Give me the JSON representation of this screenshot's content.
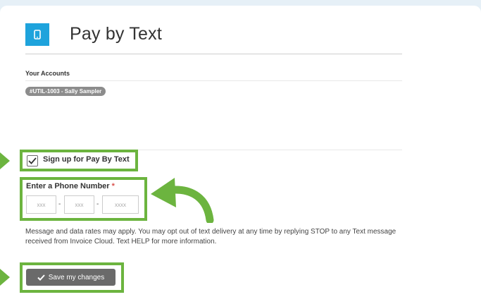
{
  "header": {
    "icon": "mobile-phone-icon",
    "title": "Pay by Text",
    "icon_color": "#1ea3dc"
  },
  "accounts": {
    "label": "Your Accounts",
    "items": [
      "#UTIL-1003 - Sally Sampler"
    ]
  },
  "signup": {
    "checked": true,
    "label": "Sign up for Pay By Text"
  },
  "phone": {
    "label": "Enter a Phone Number",
    "required_mark": "*",
    "area_placeholder": "xxx",
    "prefix_placeholder": "xxx",
    "line_placeholder": "xxxx",
    "separator": "-"
  },
  "disclaimer": "Message and data rates may apply. You may opt out of text delivery at any time by replying STOP to any Text message received from Invoice Cloud. Text HELP for more information.",
  "save": {
    "label": "Save my changes",
    "icon": "checkmark-icon"
  },
  "annotation": {
    "highlight_color": "#6cb43f"
  }
}
